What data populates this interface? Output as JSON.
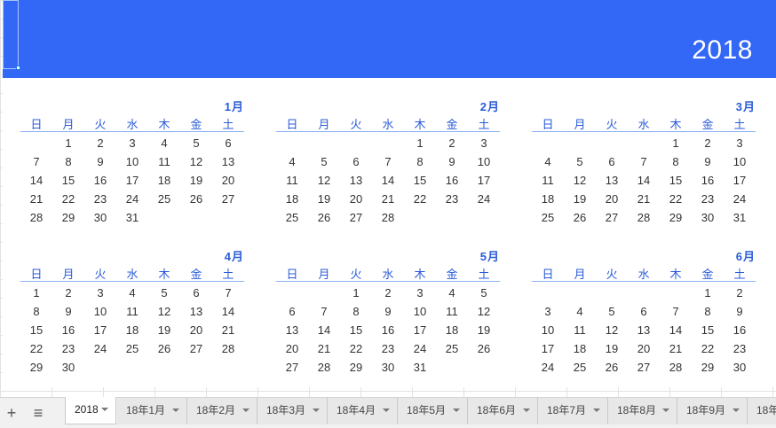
{
  "header": {
    "year": "2018"
  },
  "weekdays": [
    "日",
    "月",
    "火",
    "水",
    "木",
    "金",
    "土"
  ],
  "months": [
    {
      "title": "1月",
      "weeks": [
        [
          "",
          "1",
          "2",
          "3",
          "4",
          "5",
          "6"
        ],
        [
          "7",
          "8",
          "9",
          "10",
          "11",
          "12",
          "13"
        ],
        [
          "14",
          "15",
          "16",
          "17",
          "18",
          "19",
          "20"
        ],
        [
          "21",
          "22",
          "23",
          "24",
          "25",
          "26",
          "27"
        ],
        [
          "28",
          "29",
          "30",
          "31",
          "",
          "",
          ""
        ]
      ]
    },
    {
      "title": "2月",
      "weeks": [
        [
          "",
          "",
          "",
          "",
          "1",
          "2",
          "3"
        ],
        [
          "4",
          "5",
          "6",
          "7",
          "8",
          "9",
          "10"
        ],
        [
          "11",
          "12",
          "13",
          "14",
          "15",
          "16",
          "17"
        ],
        [
          "18",
          "19",
          "20",
          "21",
          "22",
          "23",
          "24"
        ],
        [
          "25",
          "26",
          "27",
          "28",
          "",
          "",
          ""
        ]
      ]
    },
    {
      "title": "3月",
      "weeks": [
        [
          "",
          "",
          "",
          "",
          "1",
          "2",
          "3"
        ],
        [
          "4",
          "5",
          "6",
          "7",
          "8",
          "9",
          "10"
        ],
        [
          "11",
          "12",
          "13",
          "14",
          "15",
          "16",
          "17"
        ],
        [
          "18",
          "19",
          "20",
          "21",
          "22",
          "23",
          "24"
        ],
        [
          "25",
          "26",
          "27",
          "28",
          "29",
          "30",
          "31"
        ]
      ]
    },
    {
      "title": "4月",
      "weeks": [
        [
          "1",
          "2",
          "3",
          "4",
          "5",
          "6",
          "7"
        ],
        [
          "8",
          "9",
          "10",
          "11",
          "12",
          "13",
          "14"
        ],
        [
          "15",
          "16",
          "17",
          "18",
          "19",
          "20",
          "21"
        ],
        [
          "22",
          "23",
          "24",
          "25",
          "26",
          "27",
          "28"
        ],
        [
          "29",
          "30",
          "",
          "",
          "",
          "",
          ""
        ]
      ]
    },
    {
      "title": "5月",
      "weeks": [
        [
          "",
          "",
          "1",
          "2",
          "3",
          "4",
          "5"
        ],
        [
          "6",
          "7",
          "8",
          "9",
          "10",
          "11",
          "12"
        ],
        [
          "13",
          "14",
          "15",
          "16",
          "17",
          "18",
          "19"
        ],
        [
          "20",
          "21",
          "22",
          "23",
          "24",
          "25",
          "26"
        ],
        [
          "27",
          "28",
          "29",
          "30",
          "31",
          "",
          ""
        ]
      ]
    },
    {
      "title": "6月",
      "weeks": [
        [
          "",
          "",
          "",
          "",
          "",
          "1",
          "2"
        ],
        [
          "3",
          "4",
          "5",
          "6",
          "7",
          "8",
          "9"
        ],
        [
          "10",
          "11",
          "12",
          "13",
          "14",
          "15",
          "16"
        ],
        [
          "17",
          "18",
          "19",
          "20",
          "21",
          "22",
          "23"
        ],
        [
          "24",
          "25",
          "26",
          "27",
          "28",
          "29",
          "30"
        ]
      ]
    }
  ],
  "tabbar": {
    "add_icon": "plus-icon",
    "list_icon": "menu-list-icon",
    "tabs": [
      "2018",
      "18年1月",
      "18年2月",
      "18年3月",
      "18年4月",
      "18年5月",
      "18年6月",
      "18年7月",
      "18年8月",
      "18年9月",
      "18年"
    ],
    "active_tab": "2018"
  },
  "colors": {
    "banner": "#3367f5",
    "accent": "#2a5bd7",
    "day_text": "#333333"
  }
}
